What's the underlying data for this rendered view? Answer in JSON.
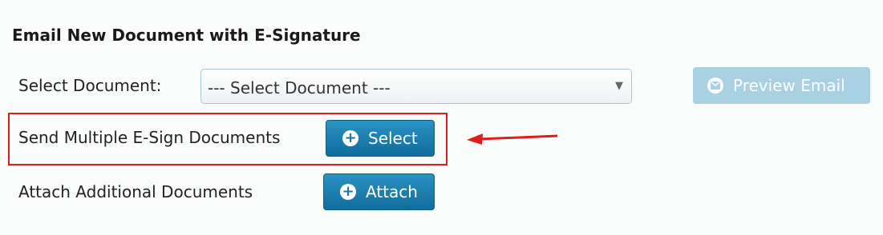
{
  "section_title": "Email New Document with E-Signature",
  "select_document": {
    "label": "Select Document:",
    "selected_value": "--- Select Document ---"
  },
  "preview_button": {
    "label": "Preview Email",
    "icon": "envelope-icon",
    "state": "disabled"
  },
  "multi_esign": {
    "label": "Send Multiple E-Sign Documents",
    "button_label": "Select",
    "button_icon": "plus-circle-icon"
  },
  "attach": {
    "label": "Attach Additional Documents",
    "button_label": "Attach",
    "button_icon": "plus-circle-icon"
  },
  "colors": {
    "button_blue": "#1778a9",
    "preview_disabled": "#a9d1e4",
    "highlight_red": "#e01b1b"
  }
}
